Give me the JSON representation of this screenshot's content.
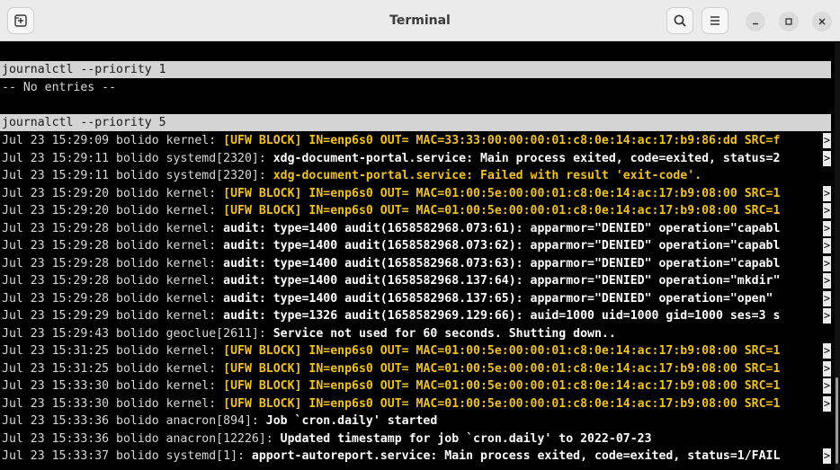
{
  "window": {
    "title": "Terminal"
  },
  "icons": {
    "new_tab": "new-tab-icon",
    "search": "search-icon",
    "menu": "hamburger-menu-icon",
    "minimize": "minimize-icon",
    "maximize": "maximize-icon",
    "close": "close-icon"
  },
  "colors": {
    "warning": "#f2c21a",
    "command_bg": "#d4d4d4",
    "terminal_bg": "#000000"
  },
  "terminal": {
    "cmd1": "journalctl --priority 1",
    "no_entries": "-- No entries --",
    "cmd2": "journalctl --priority 5",
    "trunc_glyph": ">",
    "rows": [
      {
        "prefix": "Jul 23 15:29:09 bolido kernel: ",
        "msg": "[UFW BLOCK] IN=enp6s0 OUT= MAC=33:33:00:00:00:01:c8:0e:14:ac:17:b9:86:dd SRC=f",
        "style": "warn",
        "trunc": true
      },
      {
        "prefix": "Jul 23 15:29:11 bolido systemd[2320]: ",
        "msg": "xdg-document-portal.service: Main process exited, code=exited, status=2",
        "style": "bold",
        "trunc": true
      },
      {
        "prefix": "Jul 23 15:29:11 bolido systemd[2320]: ",
        "msg": "xdg-document-portal.service: Failed with result 'exit-code'.",
        "style": "warn",
        "trunc": false
      },
      {
        "prefix": "Jul 23 15:29:20 bolido kernel: ",
        "msg": "[UFW BLOCK] IN=enp6s0 OUT= MAC=01:00:5e:00:00:01:c8:0e:14:ac:17:b9:08:00 SRC=1",
        "style": "warn",
        "trunc": true
      },
      {
        "prefix": "Jul 23 15:29:20 bolido kernel: ",
        "msg": "[UFW BLOCK] IN=enp6s0 OUT= MAC=01:00:5e:00:00:01:c8:0e:14:ac:17:b9:08:00 SRC=1",
        "style": "warn",
        "trunc": true
      },
      {
        "prefix": "Jul 23 15:29:28 bolido kernel: ",
        "msg": "audit: type=1400 audit(1658582968.073:61): apparmor=\"DENIED\" operation=\"capabl",
        "style": "bold",
        "trunc": true
      },
      {
        "prefix": "Jul 23 15:29:28 bolido kernel: ",
        "msg": "audit: type=1400 audit(1658582968.073:62): apparmor=\"DENIED\" operation=\"capabl",
        "style": "bold",
        "trunc": true
      },
      {
        "prefix": "Jul 23 15:29:28 bolido kernel: ",
        "msg": "audit: type=1400 audit(1658582968.073:63): apparmor=\"DENIED\" operation=\"capabl",
        "style": "bold",
        "trunc": true
      },
      {
        "prefix": "Jul 23 15:29:28 bolido kernel: ",
        "msg": "audit: type=1400 audit(1658582968.137:64): apparmor=\"DENIED\" operation=\"mkdir\"",
        "style": "bold",
        "trunc": true
      },
      {
        "prefix": "Jul 23 15:29:28 bolido kernel: ",
        "msg": "audit: type=1400 audit(1658582968.137:65): apparmor=\"DENIED\" operation=\"open\" ",
        "style": "bold",
        "trunc": true
      },
      {
        "prefix": "Jul 23 15:29:29 bolido kernel: ",
        "msg": "audit: type=1326 audit(1658582969.129:66): auid=1000 uid=1000 gid=1000 ses=3 s",
        "style": "bold",
        "trunc": true
      },
      {
        "prefix": "Jul 23 15:29:43 bolido geoclue[2611]: ",
        "msg": "Service not used for 60 seconds. Shutting down..",
        "style": "bold",
        "trunc": false
      },
      {
        "prefix": "Jul 23 15:31:25 bolido kernel: ",
        "msg": "[UFW BLOCK] IN=enp6s0 OUT= MAC=01:00:5e:00:00:01:c8:0e:14:ac:17:b9:08:00 SRC=1",
        "style": "warn",
        "trunc": true
      },
      {
        "prefix": "Jul 23 15:31:25 bolido kernel: ",
        "msg": "[UFW BLOCK] IN=enp6s0 OUT= MAC=01:00:5e:00:00:01:c8:0e:14:ac:17:b9:08:00 SRC=1",
        "style": "warn",
        "trunc": true
      },
      {
        "prefix": "Jul 23 15:33:30 bolido kernel: ",
        "msg": "[UFW BLOCK] IN=enp6s0 OUT= MAC=01:00:5e:00:00:01:c8:0e:14:ac:17:b9:08:00 SRC=1",
        "style": "warn",
        "trunc": true
      },
      {
        "prefix": "Jul 23 15:33:30 bolido kernel: ",
        "msg": "[UFW BLOCK] IN=enp6s0 OUT= MAC=01:00:5e:00:00:01:c8:0e:14:ac:17:b9:08:00 SRC=1",
        "style": "warn",
        "trunc": true
      },
      {
        "prefix": "Jul 23 15:33:36 bolido anacron[894]: ",
        "msg": "Job `cron.daily' started",
        "style": "bold",
        "trunc": false
      },
      {
        "prefix": "Jul 23 15:33:36 bolido anacron[12226]: ",
        "msg": "Updated timestamp for job `cron.daily' to 2022-07-23",
        "style": "bold",
        "trunc": false
      },
      {
        "prefix": "Jul 23 15:33:37 bolido systemd[1]: ",
        "msg": "apport-autoreport.service: Main process exited, code=exited, status=1/FAIL",
        "style": "bold",
        "trunc": true
      }
    ]
  }
}
